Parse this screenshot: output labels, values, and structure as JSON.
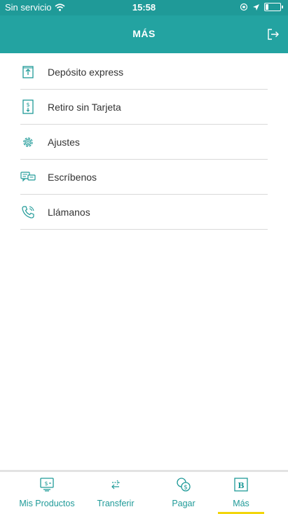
{
  "status_bar": {
    "carrier": "Sin servicio",
    "time": "15:58"
  },
  "header": {
    "title": "MÁS"
  },
  "menu": {
    "items": [
      {
        "label": "Depósito express",
        "icon": "deposit-icon"
      },
      {
        "label": "Retiro sin Tarjeta",
        "icon": "cash-withdrawal-icon"
      },
      {
        "label": "Ajustes",
        "icon": "gear-icon"
      },
      {
        "label": "Escríbenos",
        "icon": "chat-icon"
      },
      {
        "label": "Llámanos",
        "icon": "phone-icon"
      }
    ]
  },
  "tabbar": {
    "active": "Más",
    "tabs": [
      {
        "label": "Mis Productos",
        "icon": "products-icon"
      },
      {
        "label": "Transferir",
        "icon": "transfer-icon"
      },
      {
        "label": "Pagar",
        "icon": "pay-icon"
      },
      {
        "label": "Más",
        "icon": "bank-logo-icon"
      }
    ]
  },
  "colors": {
    "primary": "#23a3a1",
    "status": "#1f9a98",
    "accent": "#f2d50a"
  }
}
